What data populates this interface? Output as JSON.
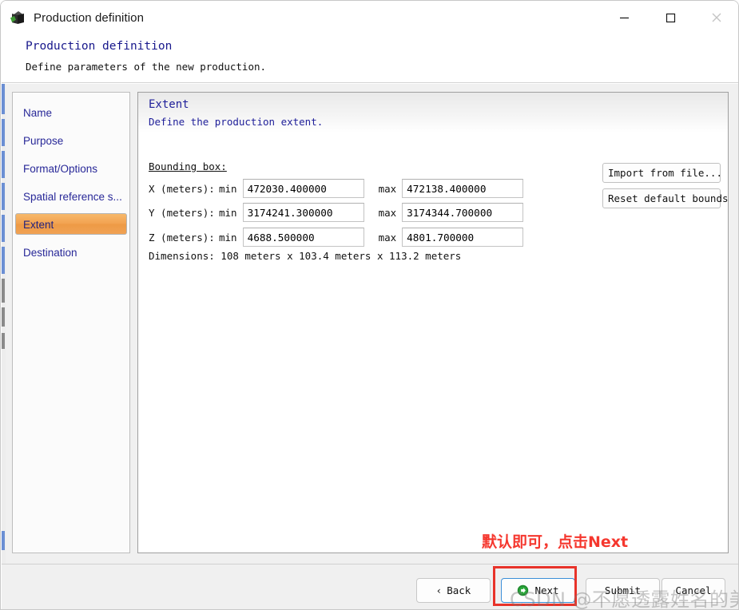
{
  "window": {
    "title": "Production definition",
    "icon": "cube-icon",
    "controls": {
      "minimize": "minimize-icon",
      "maximize": "maximize-icon",
      "close": "close-icon"
    }
  },
  "wizard_header": {
    "title": "Production definition",
    "subtitle": "Define parameters of the new production."
  },
  "sidebar": {
    "items": [
      {
        "label": "Name",
        "selected": false
      },
      {
        "label": "Purpose",
        "selected": false
      },
      {
        "label": "Format/Options",
        "selected": false
      },
      {
        "label": "Spatial reference s...",
        "selected": false
      },
      {
        "label": "Extent",
        "selected": true
      },
      {
        "label": "Destination",
        "selected": false
      }
    ],
    "selected_color": "#f0a254"
  },
  "content": {
    "title": "Extent",
    "subtitle": "Define the production extent.",
    "bounding_box_label": "Bounding box:",
    "min_label": "min",
    "max_label": "max",
    "rows": [
      {
        "axis": "X (meters):",
        "min": "472030.400000",
        "max": "472138.400000"
      },
      {
        "axis": "Y (meters):",
        "min": "3174241.300000",
        "max": "3174344.700000"
      },
      {
        "axis": "Z (meters):",
        "min": "4688.500000",
        "max": "4801.700000"
      }
    ],
    "dimensions": "Dimensions: 108 meters x 103.4 meters x 113.2 meters",
    "import_button": "Import from file...",
    "reset_button": "Reset default bounds",
    "annotation": "默认即可，点击Next",
    "annotation_color": "#f5372e"
  },
  "footer": {
    "back": "Back",
    "next": "Next",
    "submit": "Submit",
    "cancel": "Cancel",
    "next_icon": "green-arrow-right-icon",
    "back_icon": "chevron-left-icon",
    "highlight_color": "#e8332a"
  },
  "watermark": {
    "text": "CSDN @不愿透露姓名的美女"
  }
}
